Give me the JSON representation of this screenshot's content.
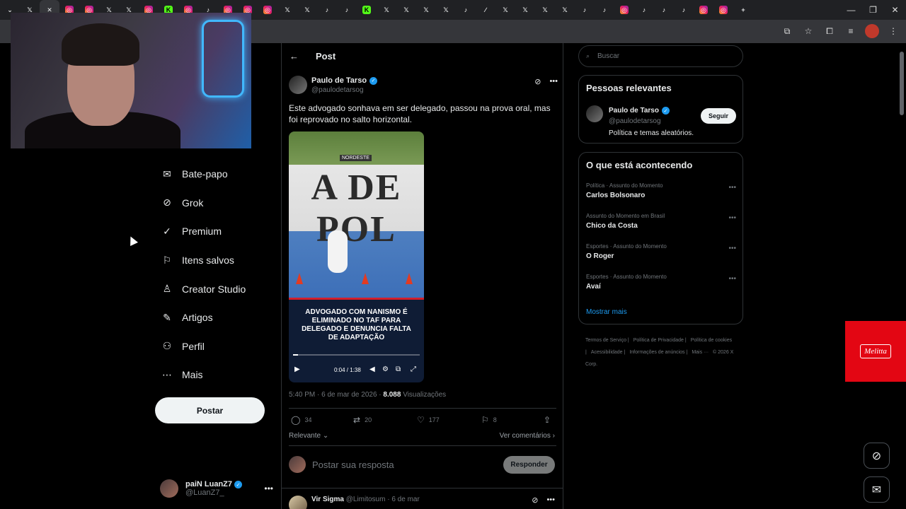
{
  "browser": {
    "tabs": [
      {
        "icon": "chevron-down-icon",
        "glyph": "⌄",
        "kind": "x"
      },
      {
        "icon": "x-icon",
        "glyph": "𝕏",
        "kind": "x"
      },
      {
        "icon": "close-icon",
        "glyph": "✕",
        "kind": "x",
        "active": true
      },
      {
        "icon": "instagram-icon",
        "glyph": "◎",
        "kind": "ig"
      },
      {
        "icon": "instagram-icon",
        "glyph": "◎",
        "kind": "ig"
      },
      {
        "icon": "x-icon",
        "glyph": "𝕏",
        "kind": "x"
      },
      {
        "icon": "x-icon",
        "glyph": "𝕏",
        "kind": "x"
      },
      {
        "icon": "instagram-icon",
        "glyph": "◎",
        "kind": "ig"
      },
      {
        "icon": "kick-icon",
        "glyph": "K",
        "kind": "k"
      },
      {
        "icon": "instagram-icon",
        "glyph": "◎",
        "kind": "ig"
      },
      {
        "icon": "tiktok-icon",
        "glyph": "♪",
        "kind": "tk"
      },
      {
        "icon": "instagram-icon",
        "glyph": "◎",
        "kind": "ig"
      },
      {
        "icon": "instagram-icon",
        "glyph": "◎",
        "kind": "ig"
      },
      {
        "icon": "instagram-icon",
        "glyph": "◎",
        "kind": "ig"
      },
      {
        "icon": "x-icon",
        "glyph": "𝕏",
        "kind": "x"
      },
      {
        "icon": "x-icon",
        "glyph": "𝕏",
        "kind": "x"
      },
      {
        "icon": "tiktok-icon",
        "glyph": "♪",
        "kind": "tk"
      },
      {
        "icon": "tiktok-icon",
        "glyph": "♪",
        "kind": "tk"
      },
      {
        "icon": "kick-icon",
        "glyph": "K",
        "kind": "k"
      },
      {
        "icon": "x-icon",
        "glyph": "𝕏",
        "kind": "x"
      },
      {
        "icon": "x-icon",
        "glyph": "𝕏",
        "kind": "x"
      },
      {
        "icon": "x-icon",
        "glyph": "𝕏",
        "kind": "x"
      },
      {
        "icon": "x-icon",
        "glyph": "𝕏",
        "kind": "x"
      },
      {
        "icon": "tiktok-icon",
        "glyph": "♪",
        "kind": "tk"
      },
      {
        "icon": "feather-icon",
        "glyph": "∕",
        "kind": "x"
      },
      {
        "icon": "x-icon",
        "glyph": "𝕏",
        "kind": "x"
      },
      {
        "icon": "x-icon",
        "glyph": "𝕏",
        "kind": "x"
      },
      {
        "icon": "x-icon",
        "glyph": "𝕏",
        "kind": "x"
      },
      {
        "icon": "x-icon",
        "glyph": "𝕏",
        "kind": "x"
      },
      {
        "icon": "tiktok-icon",
        "glyph": "♪",
        "kind": "tk"
      },
      {
        "icon": "tiktok-icon",
        "glyph": "♪",
        "kind": "tk"
      },
      {
        "icon": "instagram-icon",
        "glyph": "◎",
        "kind": "ig"
      },
      {
        "icon": "tiktok-icon",
        "glyph": "♪",
        "kind": "tk"
      },
      {
        "icon": "tiktok-icon",
        "glyph": "♪",
        "kind": "tk"
      },
      {
        "icon": "tiktok-icon",
        "glyph": "♪",
        "kind": "tk"
      },
      {
        "icon": "instagram-icon",
        "glyph": "◎",
        "kind": "ig"
      },
      {
        "icon": "instagram-icon",
        "glyph": "◎",
        "kind": "ig"
      },
      {
        "icon": "new-tab-icon",
        "glyph": "+",
        "kind": "x"
      }
    ]
  },
  "nav": {
    "items": [
      {
        "name": "chat",
        "icon": "mail-icon",
        "glyph": "✉",
        "label": "Bate-papo"
      },
      {
        "name": "grok",
        "icon": "grok-icon",
        "glyph": "⊘",
        "label": "Grok"
      },
      {
        "name": "premium",
        "icon": "verified-icon",
        "glyph": "✓",
        "label": "Premium"
      },
      {
        "name": "bookmarks",
        "icon": "bookmark-icon",
        "glyph": "⚐",
        "label": "Itens salvos"
      },
      {
        "name": "creator-studio",
        "icon": "creator-icon",
        "glyph": "♙",
        "label": "Creator Studio"
      },
      {
        "name": "articles",
        "icon": "article-icon",
        "glyph": "✎",
        "label": "Artigos"
      },
      {
        "name": "profile",
        "icon": "person-icon",
        "glyph": "⚇",
        "label": "Perfil"
      },
      {
        "name": "more",
        "icon": "more-circle-icon",
        "glyph": "⋯",
        "label": "Mais"
      }
    ],
    "post_button": "Postar",
    "me": {
      "name": "paiN LuanZ7",
      "handle": "@LuanZ7_"
    }
  },
  "post": {
    "header": "Post",
    "author_name": "Paulo de Tarso",
    "author_handle": "@paulodetarsog",
    "text": "Este advogado sonhava em ser delegado, passou na prova oral, mas foi reprovado no salto horizontal.",
    "media": {
      "banner": "A DE POL",
      "source_badge": "NORDESTE",
      "caption": "ADVOGADO COM NANISMO É ELIMINADO NO TAF PARA DELEGADO E DENUNCIA FALTA DE ADAPTAÇÃO",
      "time": "0:04 / 1:38",
      "progress": 0.04
    },
    "timestamp": "5:40 PM · 6 de mar de 2026 ·",
    "views_count": "8.088",
    "views_label": "Visualizações",
    "stats": {
      "replies": "34",
      "reposts": "20",
      "likes": "177",
      "bookmarks": "8"
    },
    "sort_label": "Relevante",
    "see_comments": "Ver comentários",
    "reply_placeholder": "Postar sua resposta",
    "reply_button": "Responder"
  },
  "comment": {
    "name": "Vir Sigma",
    "handle": "@Limitosum",
    "date": "· 6 de mar"
  },
  "sidebar": {
    "search_placeholder": "Buscar",
    "relevant_title": "Pessoas relevantes",
    "relevant_user": {
      "name": "Paulo de Tarso",
      "handle": "@paulodetarsog",
      "bio": "Política e temas aleatórios.",
      "follow": "Seguir"
    },
    "trends_title": "O que está acontecendo",
    "trends": [
      {
        "context": "Política · Assunto do Momento",
        "name": "Carlos Bolsonaro"
      },
      {
        "context": "Assunto do Momento em Brasil",
        "name": "Chico da Costa"
      },
      {
        "context": "Esportes · Assunto do Momento",
        "name": "O Roger"
      },
      {
        "context": "Esportes · Assunto do Momento",
        "name": "Avaí"
      }
    ],
    "show_more": "Mostrar mais",
    "footer_links": [
      "Termos de Serviço |",
      "Política de Privacidade |",
      "Política de cookies |",
      "Acessibilidade |",
      "Informações de anúncios |",
      "Mais ···",
      "© 2026 X Corp."
    ]
  },
  "ad": {
    "brand": "Melitta",
    "color": "#e30613"
  },
  "colors": {
    "accent": "#1d9bf0",
    "background": "#000000",
    "border": "#2f3336"
  }
}
